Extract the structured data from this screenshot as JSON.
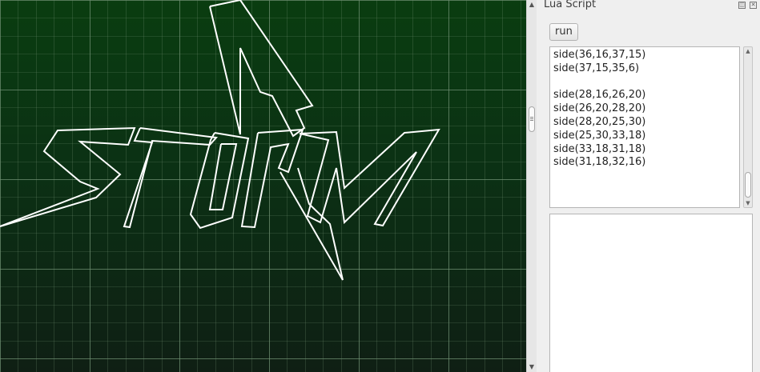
{
  "panel": {
    "title": "Lua Script",
    "run_label": "run",
    "script_lines": [
      "side(36,16,37,15)",
      "side(37,15,35,6)",
      "",
      "side(28,16,26,20)",
      "side(26,20,28,20)",
      "side(28,20,25,30)",
      "side(25,30,33,18)",
      "side(33,18,31,18)",
      "side(31,18,32,16)"
    ],
    "output_text": ""
  },
  "icons": {
    "float": "float-icon",
    "close": "close-icon"
  },
  "colors": {
    "canvas_top": "#0a3d10",
    "canvas_bottom": "#0f1f14",
    "grid": "#6f8f72",
    "stroke": "#ffffff"
  }
}
